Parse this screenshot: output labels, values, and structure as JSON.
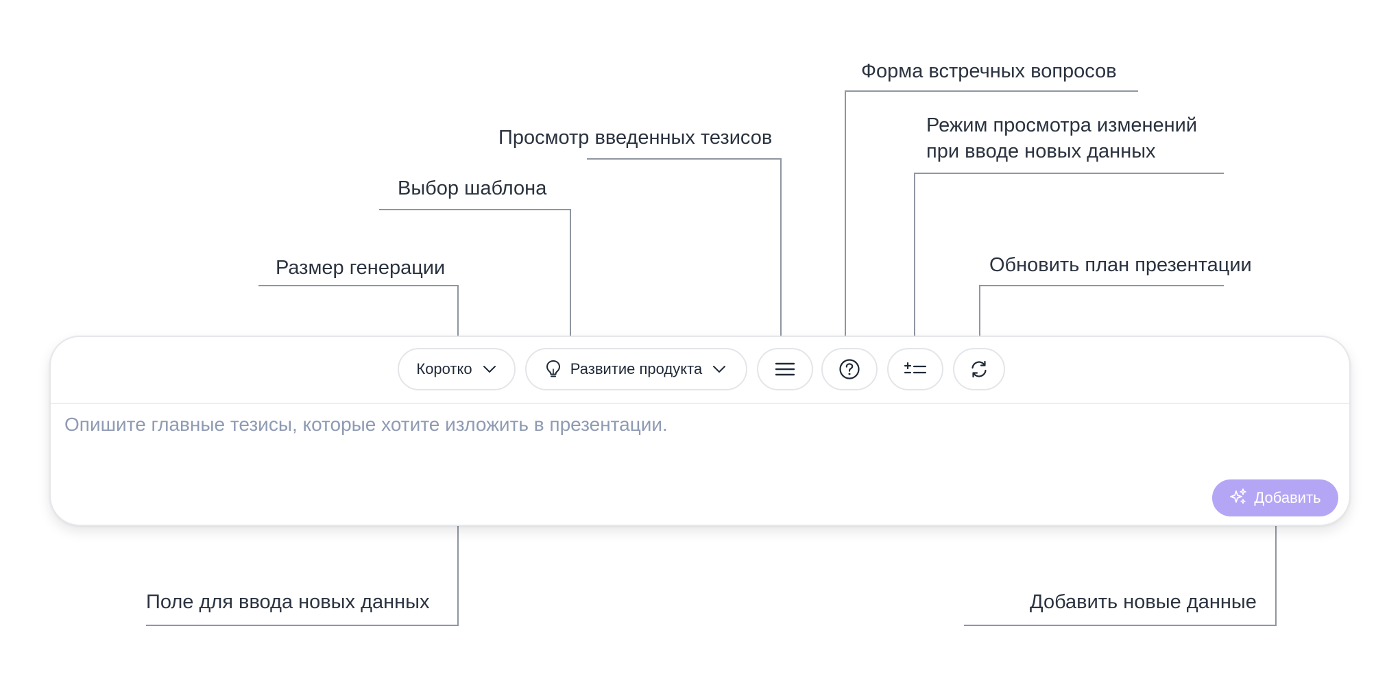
{
  "annotations": {
    "generation_size": "Размер генерации",
    "template_choice": "Выбор шаблона",
    "view_theses": "Просмотр введенных тезисов",
    "counter_questions": "Форма встречных вопросов",
    "diff_mode_line1": "Режим просмотра изменений",
    "diff_mode_line2": "при вводе новых данных",
    "refresh_plan": "Обновить план презентации",
    "input_field": "Поле для ввода новых данных",
    "add_data": "Добавить новые данные"
  },
  "toolbar": {
    "size_select": {
      "value": "Коротко",
      "icon": "chevron-down-icon"
    },
    "template_select": {
      "value": "Развитие продукта",
      "icon_left": "lightbulb-icon",
      "icon_right": "chevron-down-icon"
    },
    "theses_button_icon": "menu-lines-icon",
    "questions_button_icon": "question-circle-icon",
    "diff_button_icon": "plus-minus-list-icon",
    "refresh_button_icon": "refresh-icon"
  },
  "composer": {
    "placeholder": "Опишите главные тезисы, которые хотите изложить в презентации.",
    "add_button_label": "Добавить",
    "add_button_icon": "sparkles-icon"
  },
  "colors": {
    "accent_button": "#b5a6f5",
    "placeholder_text": "#8f9bb3",
    "annotation_line": "#8f96a0",
    "border": "#e3e5e9"
  }
}
